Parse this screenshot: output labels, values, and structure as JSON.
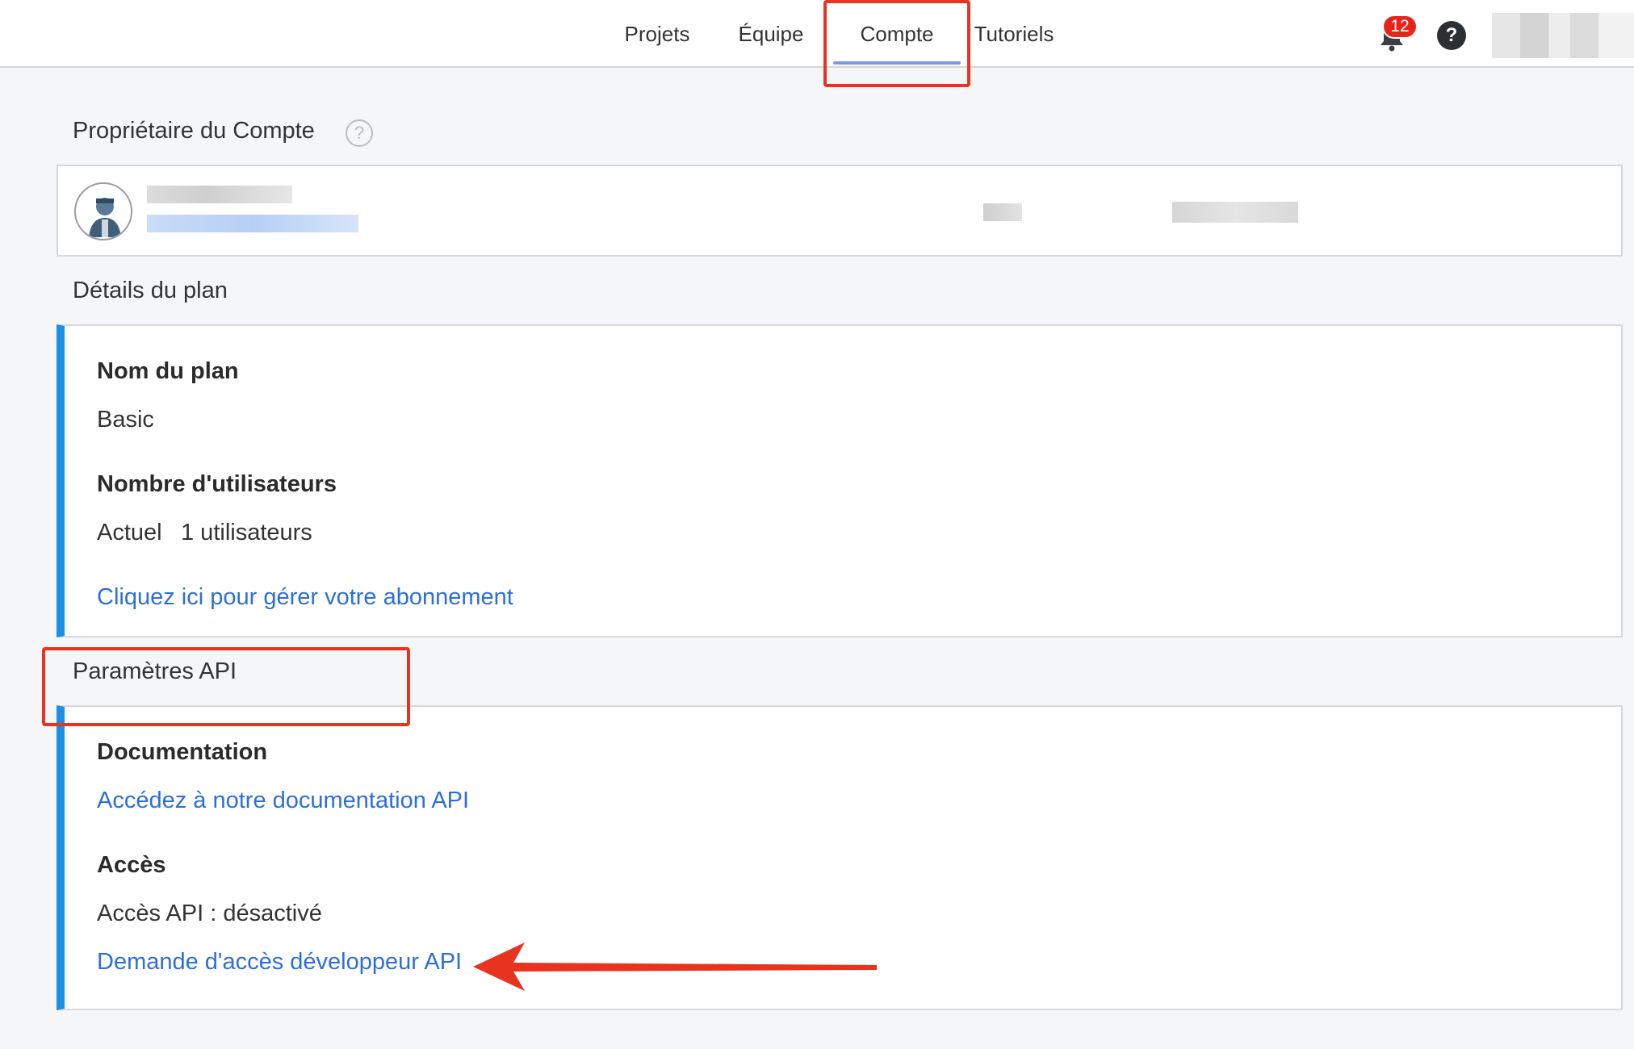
{
  "nav": {
    "tabs": [
      {
        "label": "Projets"
      },
      {
        "label": "Équipe"
      },
      {
        "label": "Compte",
        "active": true
      },
      {
        "label": "Tutoriels"
      }
    ],
    "notification_count": "12",
    "help_label": "?"
  },
  "owner": {
    "title": "Propriétaire du Compte",
    "help_glyph": "?"
  },
  "plan": {
    "title": "Détails du plan",
    "name_label": "Nom du plan",
    "name_value": "Basic",
    "users_label": "Nombre d'utilisateurs",
    "users_current_label": "Actuel",
    "users_current_value": "1 utilisateurs",
    "manage_link": "Cliquez ici pour gérer votre abonnement"
  },
  "api": {
    "title": "Paramètres API",
    "doc_label": "Documentation",
    "doc_link": "Accédez à notre documentation API",
    "access_label": "Accès",
    "access_status": "Accès API : désactivé",
    "request_link": "Demande d'accès développeur API"
  },
  "colors": {
    "accent_bar": "#1b8fe6",
    "link": "#2d6fd6",
    "annotation": "#e8331f",
    "tab_underline": "#7c98e8",
    "badge": "#e8231a"
  },
  "icons": [
    "bell-icon",
    "help-icon",
    "question-circle-icon",
    "avatar-icon",
    "annotation-arrow"
  ]
}
